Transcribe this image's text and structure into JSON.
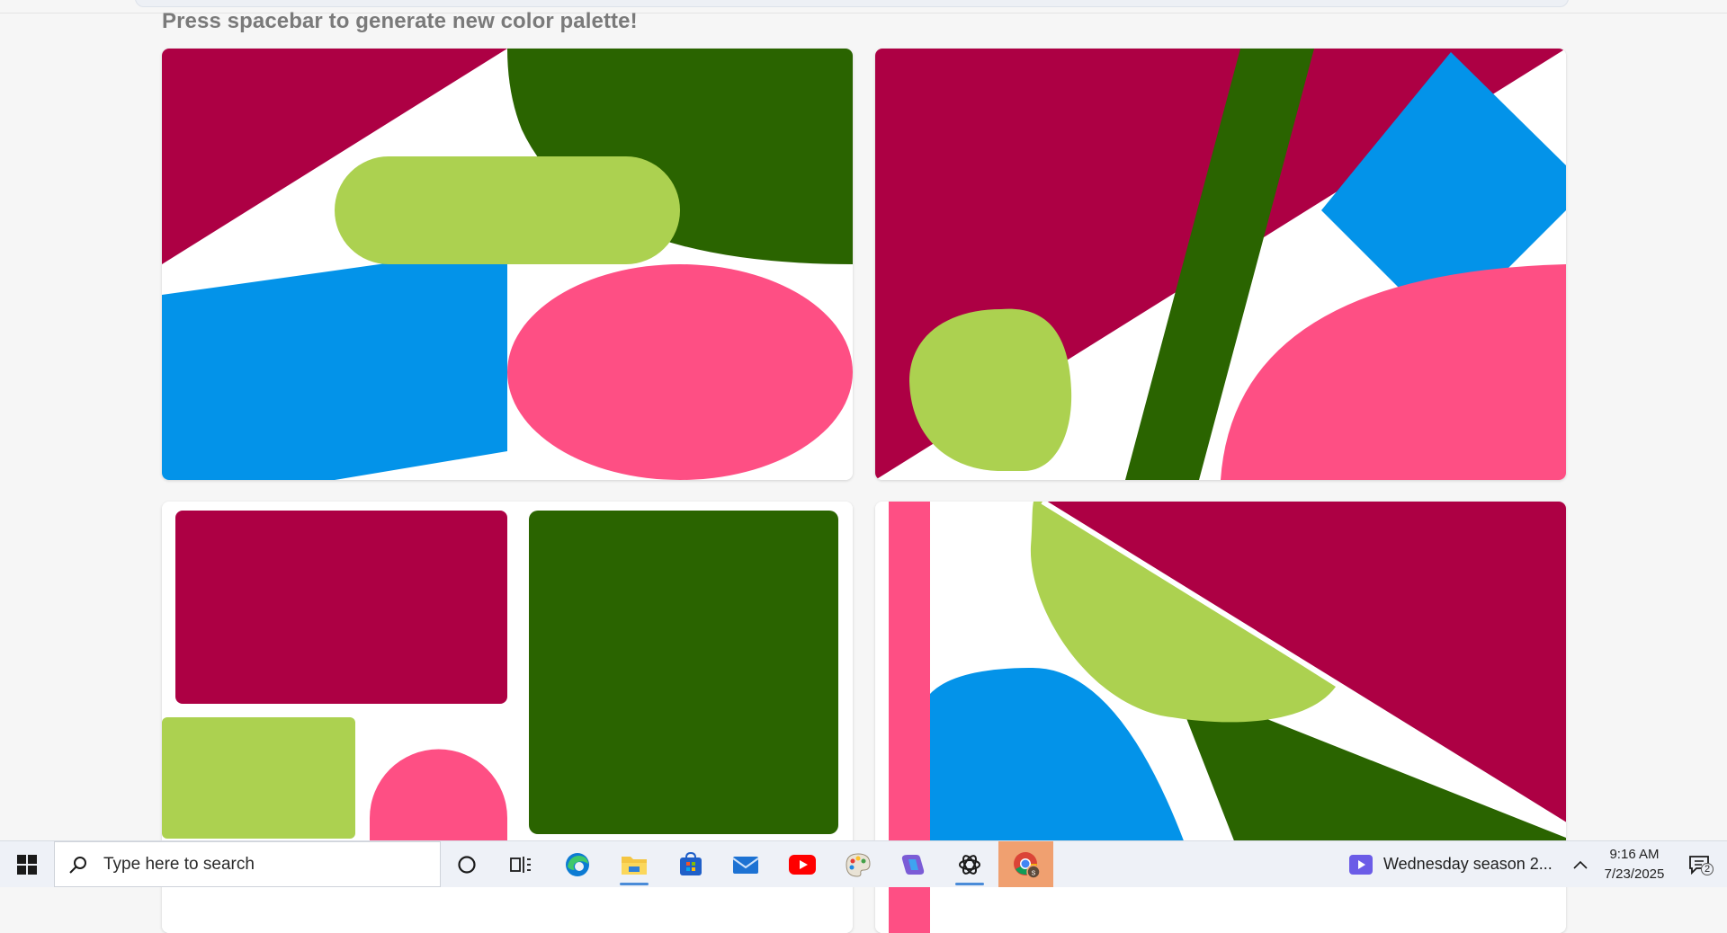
{
  "page": {
    "hint": "Press spacebar to generate new color palette!"
  },
  "palette": {
    "crimson": "#ad0044",
    "forest": "#2a6400",
    "lime": "#acd150",
    "sky": "#0393e9",
    "pink": "#fe4f84",
    "white": "#ffffff"
  },
  "cards": [
    {
      "label": "card-1"
    },
    {
      "label": "card-2"
    },
    {
      "label": "card-3"
    },
    {
      "label": "card-4"
    }
  ],
  "taskbar": {
    "search_placeholder": "Type here to search",
    "apps": [
      {
        "name": "cortana-icon"
      },
      {
        "name": "task-view-icon"
      },
      {
        "name": "edge-icon"
      },
      {
        "name": "file-explorer-icon",
        "running": true
      },
      {
        "name": "microsoft-store-icon"
      },
      {
        "name": "mail-icon"
      },
      {
        "name": "youtube-icon"
      },
      {
        "name": "paint-icon"
      },
      {
        "name": "copilot-icon"
      },
      {
        "name": "chatgpt-icon",
        "running": true
      },
      {
        "name": "chrome-icon",
        "active": true
      }
    ],
    "media_title": "Wednesday season 2...",
    "time": "9:16 AM",
    "date": "7/23/2025",
    "notification_count": "2"
  }
}
